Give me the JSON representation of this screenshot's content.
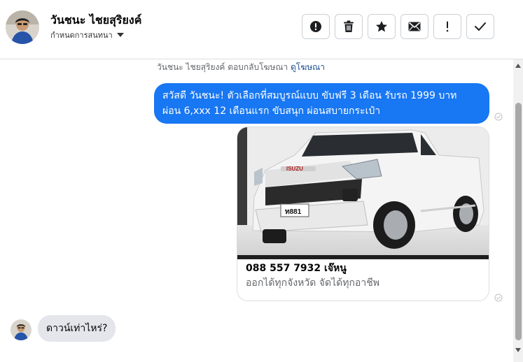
{
  "header": {
    "contact_name": "วันชนะ ไชยสุริยงค์",
    "subtitle": "กำหนดการสนทนา",
    "actions": [
      {
        "icon": "alert-circle-icon"
      },
      {
        "icon": "trash-icon"
      },
      {
        "icon": "star-icon"
      },
      {
        "icon": "mail-icon"
      },
      {
        "icon": "exclamation-icon"
      },
      {
        "icon": "check-icon"
      }
    ]
  },
  "conversation": {
    "notice_text": "วันชนะ ไชยสุริยงค์ ตอบกลับโฆษณา",
    "notice_link": "ดูโฆษณา",
    "outgoing_message": {
      "line1": "สวัสดี วันชนะ! ตัวเลือกที่สมบูรณ์แบบ ขับฟรี 3 เดือน รับรถ 1999 บาท",
      "line2": "ผ่อน 6,xxx 12 เดือนแรก ขับสนุก ผ่อนสบายกระเป๋า"
    },
    "ad_card": {
      "title": "088 557 7932 เจ๊หนู",
      "subtitle": "ออกได้ทุกจังหวัด จัดได้ทุกอาชีพ",
      "image_brand": "ISUZU",
      "plate": "ท881"
    },
    "incoming_message": "ดาวน์เท่าไหร่?"
  },
  "colors": {
    "accent": "#1877f2",
    "incoming_bubble": "#e4e6eb",
    "secondary_text": "#65676b"
  }
}
